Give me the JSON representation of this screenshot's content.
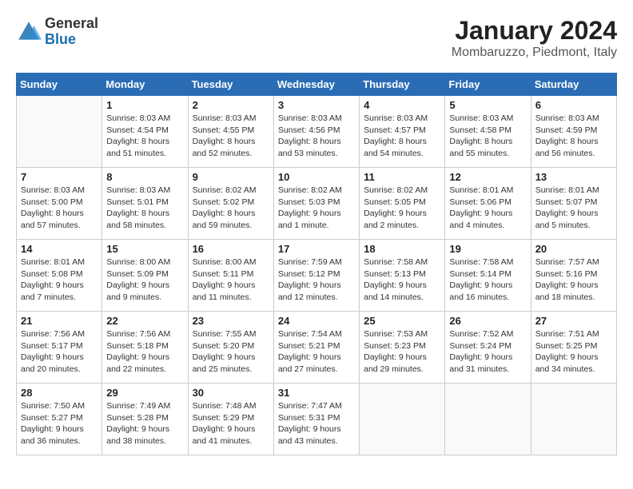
{
  "logo": {
    "general": "General",
    "blue": "Blue"
  },
  "header": {
    "title": "January 2024",
    "subtitle": "Mombaruzzo, Piedmont, Italy"
  },
  "weekdays": [
    "Sunday",
    "Monday",
    "Tuesday",
    "Wednesday",
    "Thursday",
    "Friday",
    "Saturday"
  ],
  "weeks": [
    [
      {
        "day": "",
        "info": ""
      },
      {
        "day": "1",
        "info": "Sunrise: 8:03 AM\nSunset: 4:54 PM\nDaylight: 8 hours\nand 51 minutes."
      },
      {
        "day": "2",
        "info": "Sunrise: 8:03 AM\nSunset: 4:55 PM\nDaylight: 8 hours\nand 52 minutes."
      },
      {
        "day": "3",
        "info": "Sunrise: 8:03 AM\nSunset: 4:56 PM\nDaylight: 8 hours\nand 53 minutes."
      },
      {
        "day": "4",
        "info": "Sunrise: 8:03 AM\nSunset: 4:57 PM\nDaylight: 8 hours\nand 54 minutes."
      },
      {
        "day": "5",
        "info": "Sunrise: 8:03 AM\nSunset: 4:58 PM\nDaylight: 8 hours\nand 55 minutes."
      },
      {
        "day": "6",
        "info": "Sunrise: 8:03 AM\nSunset: 4:59 PM\nDaylight: 8 hours\nand 56 minutes."
      }
    ],
    [
      {
        "day": "7",
        "info": "Sunrise: 8:03 AM\nSunset: 5:00 PM\nDaylight: 8 hours\nand 57 minutes."
      },
      {
        "day": "8",
        "info": "Sunrise: 8:03 AM\nSunset: 5:01 PM\nDaylight: 8 hours\nand 58 minutes."
      },
      {
        "day": "9",
        "info": "Sunrise: 8:02 AM\nSunset: 5:02 PM\nDaylight: 8 hours\nand 59 minutes."
      },
      {
        "day": "10",
        "info": "Sunrise: 8:02 AM\nSunset: 5:03 PM\nDaylight: 9 hours\nand 1 minute."
      },
      {
        "day": "11",
        "info": "Sunrise: 8:02 AM\nSunset: 5:05 PM\nDaylight: 9 hours\nand 2 minutes."
      },
      {
        "day": "12",
        "info": "Sunrise: 8:01 AM\nSunset: 5:06 PM\nDaylight: 9 hours\nand 4 minutes."
      },
      {
        "day": "13",
        "info": "Sunrise: 8:01 AM\nSunset: 5:07 PM\nDaylight: 9 hours\nand 5 minutes."
      }
    ],
    [
      {
        "day": "14",
        "info": "Sunrise: 8:01 AM\nSunset: 5:08 PM\nDaylight: 9 hours\nand 7 minutes."
      },
      {
        "day": "15",
        "info": "Sunrise: 8:00 AM\nSunset: 5:09 PM\nDaylight: 9 hours\nand 9 minutes."
      },
      {
        "day": "16",
        "info": "Sunrise: 8:00 AM\nSunset: 5:11 PM\nDaylight: 9 hours\nand 11 minutes."
      },
      {
        "day": "17",
        "info": "Sunrise: 7:59 AM\nSunset: 5:12 PM\nDaylight: 9 hours\nand 12 minutes."
      },
      {
        "day": "18",
        "info": "Sunrise: 7:58 AM\nSunset: 5:13 PM\nDaylight: 9 hours\nand 14 minutes."
      },
      {
        "day": "19",
        "info": "Sunrise: 7:58 AM\nSunset: 5:14 PM\nDaylight: 9 hours\nand 16 minutes."
      },
      {
        "day": "20",
        "info": "Sunrise: 7:57 AM\nSunset: 5:16 PM\nDaylight: 9 hours\nand 18 minutes."
      }
    ],
    [
      {
        "day": "21",
        "info": "Sunrise: 7:56 AM\nSunset: 5:17 PM\nDaylight: 9 hours\nand 20 minutes."
      },
      {
        "day": "22",
        "info": "Sunrise: 7:56 AM\nSunset: 5:18 PM\nDaylight: 9 hours\nand 22 minutes."
      },
      {
        "day": "23",
        "info": "Sunrise: 7:55 AM\nSunset: 5:20 PM\nDaylight: 9 hours\nand 25 minutes."
      },
      {
        "day": "24",
        "info": "Sunrise: 7:54 AM\nSunset: 5:21 PM\nDaylight: 9 hours\nand 27 minutes."
      },
      {
        "day": "25",
        "info": "Sunrise: 7:53 AM\nSunset: 5:23 PM\nDaylight: 9 hours\nand 29 minutes."
      },
      {
        "day": "26",
        "info": "Sunrise: 7:52 AM\nSunset: 5:24 PM\nDaylight: 9 hours\nand 31 minutes."
      },
      {
        "day": "27",
        "info": "Sunrise: 7:51 AM\nSunset: 5:25 PM\nDaylight: 9 hours\nand 34 minutes."
      }
    ],
    [
      {
        "day": "28",
        "info": "Sunrise: 7:50 AM\nSunset: 5:27 PM\nDaylight: 9 hours\nand 36 minutes."
      },
      {
        "day": "29",
        "info": "Sunrise: 7:49 AM\nSunset: 5:28 PM\nDaylight: 9 hours\nand 38 minutes."
      },
      {
        "day": "30",
        "info": "Sunrise: 7:48 AM\nSunset: 5:29 PM\nDaylight: 9 hours\nand 41 minutes."
      },
      {
        "day": "31",
        "info": "Sunrise: 7:47 AM\nSunset: 5:31 PM\nDaylight: 9 hours\nand 43 minutes."
      },
      {
        "day": "",
        "info": ""
      },
      {
        "day": "",
        "info": ""
      },
      {
        "day": "",
        "info": ""
      }
    ]
  ]
}
